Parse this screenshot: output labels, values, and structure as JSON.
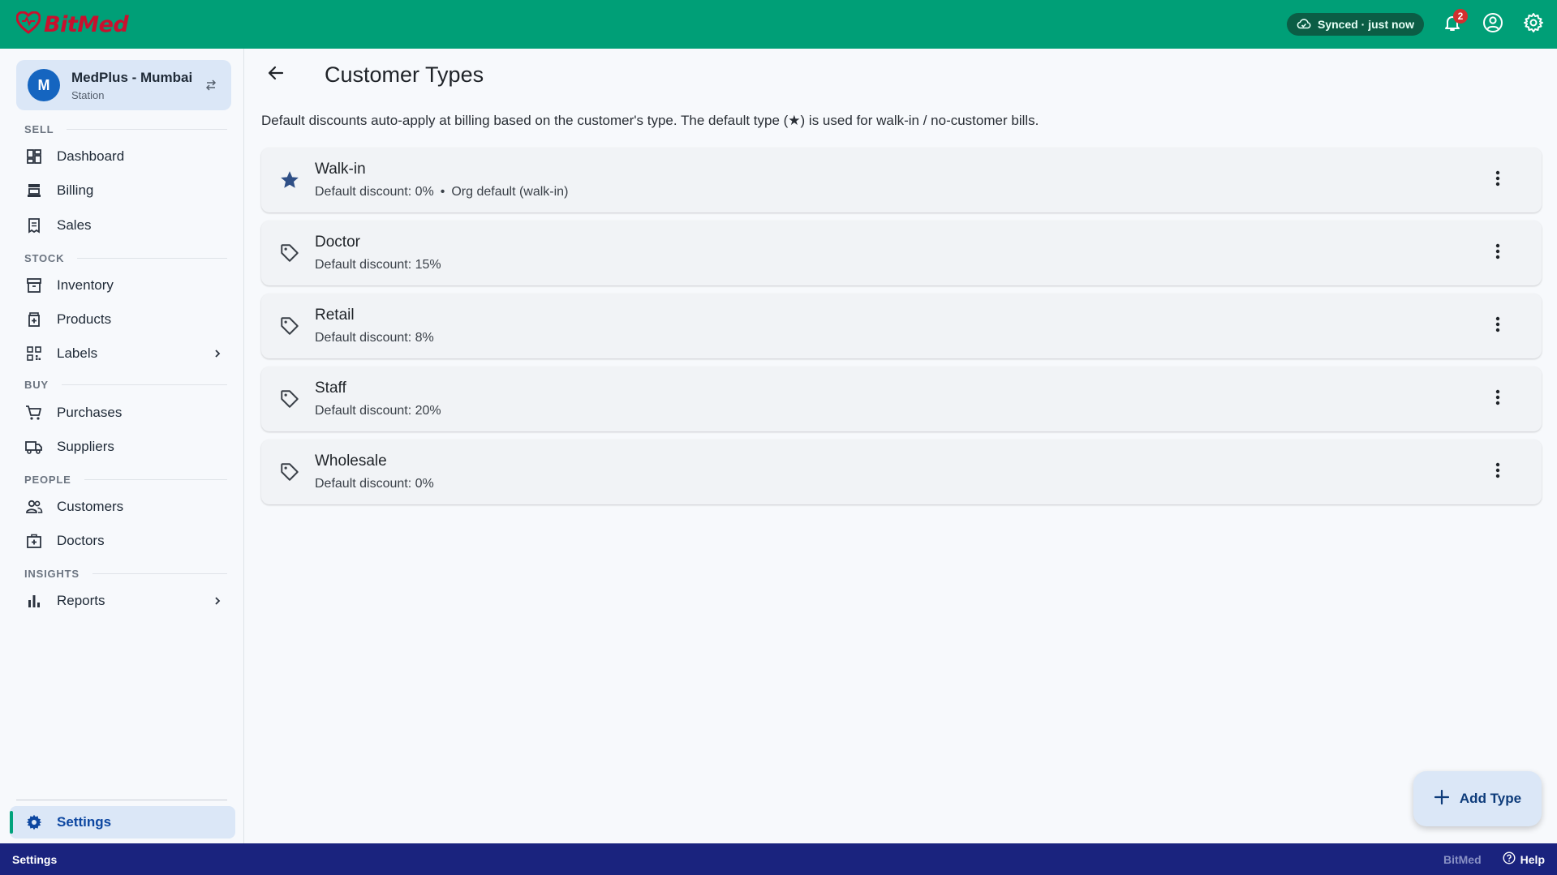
{
  "app": {
    "brand": "BitMed"
  },
  "topbar": {
    "sync_status": "Synced · just now",
    "notification_count": "2"
  },
  "sidebar": {
    "station": {
      "initial": "M",
      "name": "MedPlus - Mumbai",
      "sub": "Station"
    },
    "sections": {
      "sell": "SELL",
      "stock": "STOCK",
      "buy": "BUY",
      "people": "PEOPLE",
      "insights": "INSIGHTS"
    },
    "items": {
      "dashboard": "Dashboard",
      "billing": "Billing",
      "sales": "Sales",
      "inventory": "Inventory",
      "products": "Products",
      "labels": "Labels",
      "purchases": "Purchases",
      "suppliers": "Suppliers",
      "customers": "Customers",
      "doctors": "Doctors",
      "reports": "Reports",
      "settings": "Settings"
    }
  },
  "main": {
    "title": "Customer Types",
    "description": "Default discounts auto-apply at billing based on the customer's type. The default type (★) is used for walk-in / no-customer bills.",
    "types": [
      {
        "name": "Walk-in",
        "discount": "Default discount: 0%",
        "extra": "Org default (walk-in)",
        "icon": "star-icon",
        "is_default": true
      },
      {
        "name": "Doctor",
        "discount": "Default discount: 15%",
        "icon": "tag-icon"
      },
      {
        "name": "Retail",
        "discount": "Default discount: 8%",
        "icon": "tag-icon"
      },
      {
        "name": "Staff",
        "discount": "Default discount: 20%",
        "icon": "tag-icon"
      },
      {
        "name": "Wholesale",
        "discount": "Default discount: 0%",
        "icon": "tag-icon"
      }
    ],
    "separator": "•",
    "add_button_label": "Add Type"
  },
  "statusbar": {
    "left": "Settings",
    "brand": "BitMed",
    "help": "Help"
  },
  "colors": {
    "topbar": "#009f77",
    "accent": "#1565c0",
    "statusbar": "#1a237e",
    "badge": "#d32f2f"
  }
}
